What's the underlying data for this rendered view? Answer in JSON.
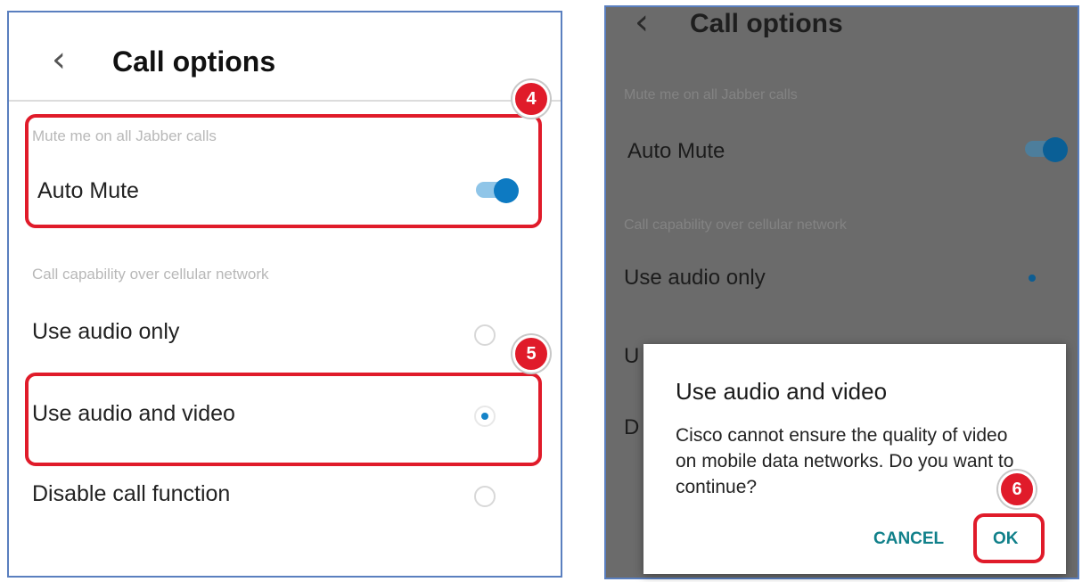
{
  "left_screen": {
    "title": "Call options",
    "mute_section_label": "Mute me on all Jabber calls",
    "auto_mute_label": "Auto Mute",
    "auto_mute_on": true,
    "network_section_label": "Call capability over cellular network",
    "options": [
      {
        "label": "Use audio only",
        "selected": false
      },
      {
        "label": "Use audio and video",
        "selected": true
      },
      {
        "label": "Disable call function",
        "selected": false
      }
    ]
  },
  "right_screen": {
    "title": "Call options",
    "mute_section_label": "Mute me on all Jabber calls",
    "auto_mute_label": "Auto Mute",
    "auto_mute_on": true,
    "network_section_label": "Call capability over cellular network",
    "audio_only_label": "Use audio only",
    "partial_row_2": "U",
    "partial_row_3": "D"
  },
  "dialog": {
    "title": "Use audio and video",
    "message": "Cisco cannot ensure the quality of video on mobile data networks. Do you want to continue?",
    "cancel_label": "CANCEL",
    "ok_label": "OK"
  },
  "step_badges": [
    "4",
    "5",
    "6"
  ],
  "colors": {
    "highlight": "#e01b2a",
    "accent_blue": "#0d7ac2",
    "dialog_button": "#10808a",
    "panel_border": "#5a7fbf"
  }
}
